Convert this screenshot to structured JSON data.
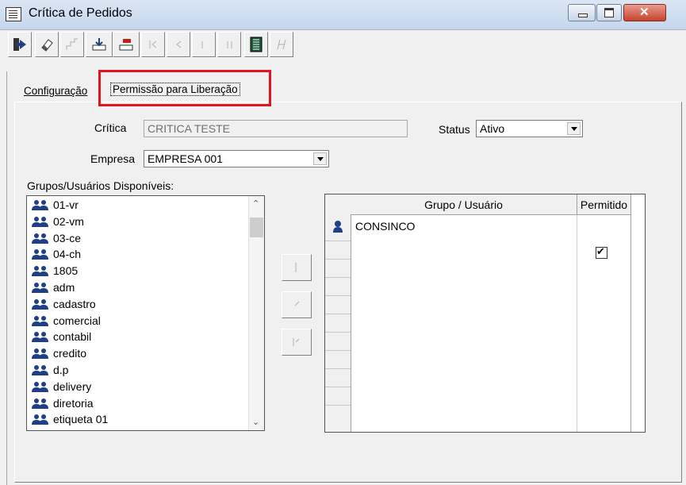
{
  "window": {
    "title": "Crítica de Pedidos"
  },
  "tabs": {
    "config": "Configuração",
    "permission": "Permissão para Liberação"
  },
  "form": {
    "critica_label": "Crítica",
    "critica_value": "CRITICA TESTE",
    "status_label": "Status",
    "status_value": "Ativo",
    "empresa_label": "Empresa",
    "empresa_value": "EMPRESA 001"
  },
  "available": {
    "label": "Grupos/Usuários Disponíveis:",
    "items": [
      "01-vr",
      "02-vm",
      "03-ce",
      "04-ch",
      "1805",
      "adm",
      "cadastro",
      "comercial",
      "contabil",
      "credito",
      "d.p",
      "delivery",
      "diretoria",
      "etiqueta 01"
    ]
  },
  "grid": {
    "header_user": "Grupo / Usuário",
    "header_allowed": "Permitido",
    "rows": [
      {
        "name": "CONSINCO",
        "allowed": true
      }
    ]
  },
  "colors": {
    "highlight": "#e0161f",
    "icon_blue": "#1f3f86"
  }
}
